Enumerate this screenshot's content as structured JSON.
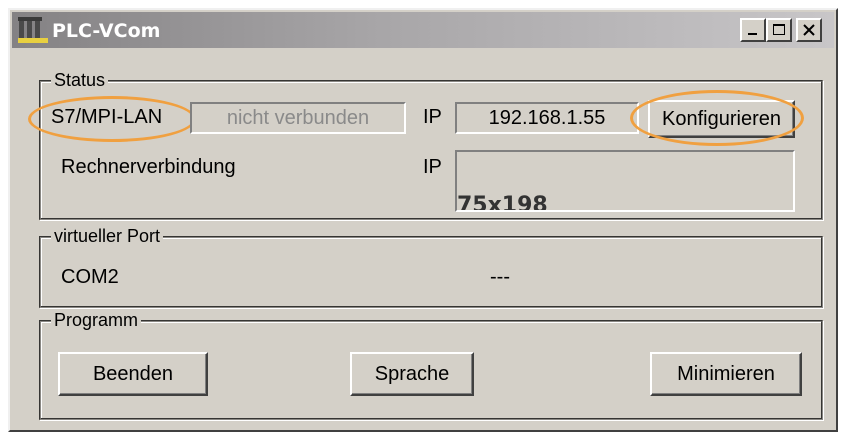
{
  "window": {
    "title": "PLC-VCom"
  },
  "status": {
    "group_label": "Status",
    "interface_label": "S7/MPI-LAN",
    "connection_state": "nicht verbunden",
    "ip_label": "IP",
    "ip_value": "192.168.1.55",
    "configure_button": "Konfigurieren",
    "computer_connection_label": "Rechnerverbindung",
    "computer_ip_label": "IP",
    "computer_ip_overlay": "75x198"
  },
  "port": {
    "group_label": "virtueller Port",
    "port_name": "COM2",
    "port_state": "---"
  },
  "program": {
    "group_label": "Programm",
    "quit_button": "Beenden",
    "language_button": "Sprache",
    "minimize_button": "Minimieren"
  },
  "colors": {
    "highlight": "#f0a040",
    "face": "#d4d0c8"
  },
  "icons": [
    "app-icon",
    "minimize-icon",
    "maximize-icon",
    "close-icon"
  ]
}
